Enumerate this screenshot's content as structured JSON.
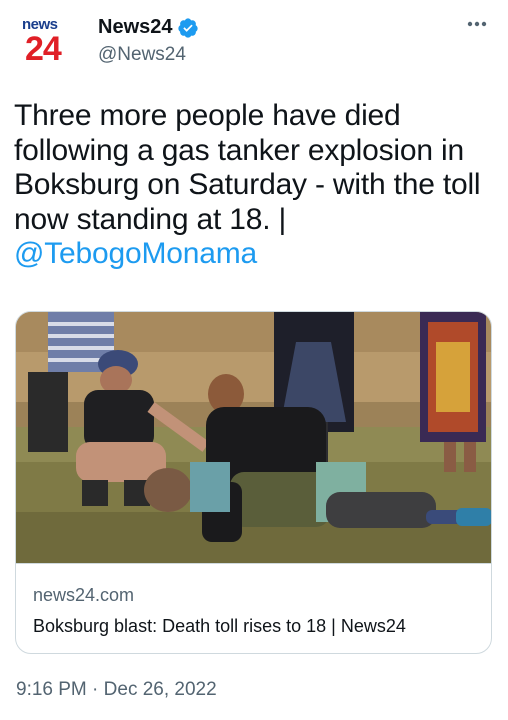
{
  "account": {
    "avatar_word": "news",
    "avatar_number": "24",
    "display_name": "News24",
    "handle": "@News24",
    "verified": true
  },
  "tweet": {
    "text": "Three more people have died following a gas tanker explosion in Boksburg on Saturday - with the toll now standing at 18. |",
    "mention": "@TebogoMonama"
  },
  "link_card": {
    "image_icon": "news-photo",
    "domain": "news24.com",
    "title": "Boksburg blast: Death toll rises to 18 | News24"
  },
  "meta": {
    "time": "9:16 PM",
    "separator": "·",
    "date": "Dec 26, 2022"
  },
  "icons": {
    "verified": "verified-badge-icon",
    "more": "more-options-icon"
  },
  "colors": {
    "brand_blue": "#1d9bf0",
    "news24_red": "#e01f26",
    "news24_navy": "#1a3e8c"
  }
}
